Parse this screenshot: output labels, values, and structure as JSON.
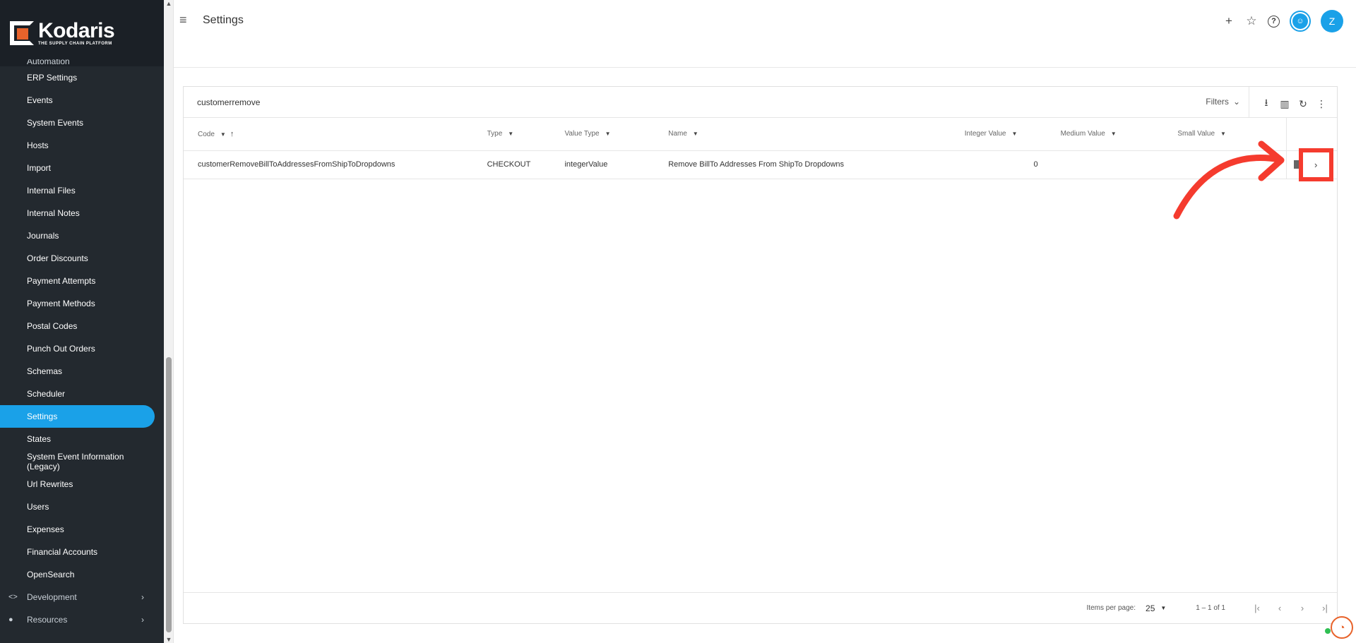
{
  "brand": {
    "name": "Kodaris",
    "tagline": "THE SUPPLY CHAIN PLATFORM",
    "accent": "#1aa1e8",
    "logo_color": "#e8632b"
  },
  "sidebar": {
    "items": [
      {
        "label": "Automation"
      },
      {
        "label": "ERP Settings"
      },
      {
        "label": "Events"
      },
      {
        "label": "System Events"
      },
      {
        "label": "Hosts"
      },
      {
        "label": "Import"
      },
      {
        "label": "Internal Files"
      },
      {
        "label": "Internal Notes"
      },
      {
        "label": "Journals"
      },
      {
        "label": "Order Discounts"
      },
      {
        "label": "Payment Attempts"
      },
      {
        "label": "Payment Methods"
      },
      {
        "label": "Postal Codes"
      },
      {
        "label": "Punch Out Orders"
      },
      {
        "label": "Schemas"
      },
      {
        "label": "Scheduler"
      },
      {
        "label": "Settings"
      },
      {
        "label": "States"
      },
      {
        "label": "System Event Information (Legacy)"
      },
      {
        "label": "Url Rewrites"
      },
      {
        "label": "Users"
      },
      {
        "label": "Expenses"
      },
      {
        "label": "Financial Accounts"
      },
      {
        "label": "OpenSearch"
      }
    ],
    "active": "Settings",
    "groups": [
      {
        "label": "Development",
        "icon": "code-icon"
      },
      {
        "label": "Resources",
        "icon": "help-circle-icon"
      }
    ]
  },
  "header": {
    "title": "Settings",
    "avatar_initial": "Z"
  },
  "toolbar": {
    "search_value": "customerremove",
    "filters_label": "Filters"
  },
  "table": {
    "columns": [
      "Code",
      "Type",
      "Value Type",
      "Name",
      "Integer Value",
      "Medium Value",
      "Small Value"
    ],
    "rows": [
      {
        "code": "customerRemoveBillToAddressesFromShipToDropdowns",
        "type": "CHECKOUT",
        "value_type": "integerValue",
        "name": "Remove BillTo Addresses From ShipTo Dropdowns",
        "integer_value": "0",
        "medium_value": "",
        "small_value": ""
      }
    ]
  },
  "paginator": {
    "items_per_page_label": "Items per page:",
    "items_per_page": "25",
    "range": "1 – 1 of 1"
  }
}
